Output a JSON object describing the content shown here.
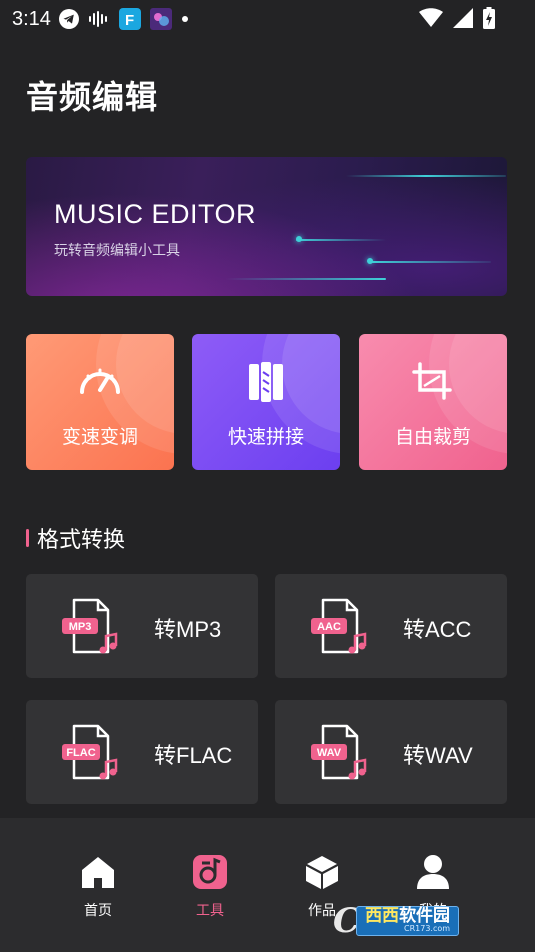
{
  "status_bar": {
    "time": "3:14",
    "icons": [
      "telegram-icon",
      "audio-wave-icon",
      "app-f-icon",
      "game-app-icon",
      "notification-dot-icon",
      "wifi-icon",
      "signal-icon",
      "battery-charging-icon"
    ]
  },
  "page_title": "音频编辑",
  "banner": {
    "title": "MUSIC EDITOR",
    "subtitle": "玩转音频编辑小工具"
  },
  "tools": [
    {
      "label": "变速变调",
      "icon": "speedometer-icon"
    },
    {
      "label": "快速拼接",
      "icon": "splice-icon"
    },
    {
      "label": "自由裁剪",
      "icon": "crop-icon"
    }
  ],
  "section_title": "格式转换",
  "converters": [
    {
      "badge": "MP3",
      "label": "转MP3"
    },
    {
      "badge": "AAC",
      "label": "转ACC"
    },
    {
      "badge": "FLAC",
      "label": "转FLAC"
    },
    {
      "badge": "WAV",
      "label": "转WAV"
    }
  ],
  "bottom_nav": [
    {
      "label": "首页",
      "icon": "home-icon",
      "active": false
    },
    {
      "label": "工具",
      "icon": "tools-icon",
      "active": true
    },
    {
      "label": "作品",
      "icon": "cube-icon",
      "active": false
    },
    {
      "label": "我的",
      "icon": "user-icon",
      "active": false
    }
  ],
  "watermark": {
    "letter": "C",
    "main_a": "西西",
    "main_b": "软件园",
    "sub": "CR173.com"
  },
  "colors": {
    "background": "#232325",
    "accent": "#f0628e",
    "card": "#333335",
    "speed_card": "#fb7350",
    "join_card": "#6c3ff0",
    "crop_card": "#f0628e"
  }
}
